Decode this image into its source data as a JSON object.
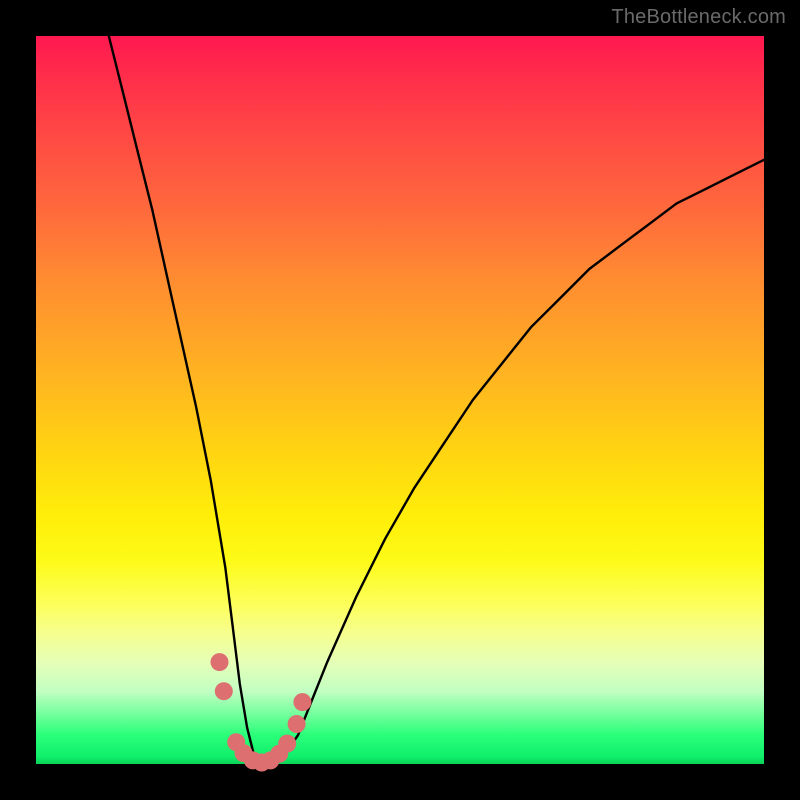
{
  "watermark": "TheBottleneck.com",
  "chart_data": {
    "type": "line",
    "title": "",
    "xlabel": "",
    "ylabel": "",
    "xlim": [
      0,
      100
    ],
    "ylim": [
      0,
      100
    ],
    "series": [
      {
        "name": "bottleneck-curve",
        "x": [
          10,
          12,
          14,
          16,
          18,
          20,
          22,
          24,
          26,
          27,
          28,
          29,
          30,
          31,
          32,
          33,
          34,
          36,
          38,
          40,
          44,
          48,
          52,
          56,
          60,
          64,
          68,
          72,
          76,
          80,
          84,
          88,
          92,
          96,
          100
        ],
        "values": [
          100,
          92,
          84,
          76,
          67,
          58,
          49,
          39,
          27,
          19,
          11,
          5,
          1,
          0,
          0,
          0,
          1,
          4,
          9,
          14,
          23,
          31,
          38,
          44,
          50,
          55,
          60,
          64,
          68,
          71,
          74,
          77,
          79,
          81,
          83
        ]
      }
    ],
    "markers": {
      "name": "marker-dots",
      "color": "#dd6f70",
      "points": [
        {
          "x": 25.2,
          "y": 14
        },
        {
          "x": 25.8,
          "y": 10
        },
        {
          "x": 27.5,
          "y": 3
        },
        {
          "x": 28.5,
          "y": 1.5
        },
        {
          "x": 29.8,
          "y": 0.5
        },
        {
          "x": 31.0,
          "y": 0.2
        },
        {
          "x": 32.2,
          "y": 0.5
        },
        {
          "x": 33.4,
          "y": 1.4
        },
        {
          "x": 34.5,
          "y": 2.8
        },
        {
          "x": 35.8,
          "y": 5.5
        },
        {
          "x": 36.6,
          "y": 8.5
        }
      ]
    },
    "gradient_stops": [
      {
        "pos": 0.0,
        "color": "#ff1850"
      },
      {
        "pos": 0.3,
        "color": "#ff7a34"
      },
      {
        "pos": 0.6,
        "color": "#ffe00c"
      },
      {
        "pos": 0.8,
        "color": "#fbff70"
      },
      {
        "pos": 0.96,
        "color": "#2bff7a"
      },
      {
        "pos": 1.0,
        "color": "#0bd356"
      }
    ]
  }
}
